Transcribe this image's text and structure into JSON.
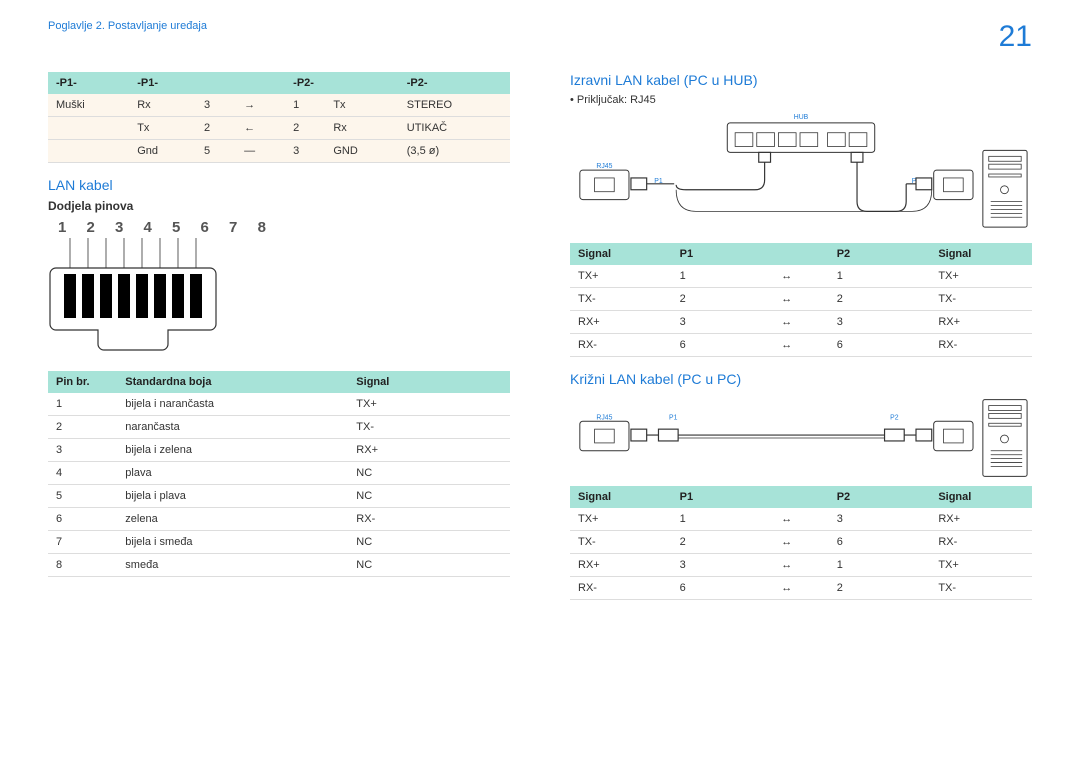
{
  "header": {
    "breadcrumb": "Poglavlje 2. Postavljanje uređaja",
    "page_number": "21"
  },
  "left": {
    "table1": {
      "headers": [
        "-P1-",
        "-P1-",
        "",
        "-P2-",
        "-P2-",
        ""
      ],
      "rows": [
        [
          "Muški",
          "Rx",
          "3",
          "→",
          "1",
          "Tx",
          "STEREO"
        ],
        [
          "",
          "Tx",
          "2",
          "←",
          "2",
          "Rx",
          "UTIKAČ"
        ],
        [
          "",
          "Gnd",
          "5",
          "—",
          "3",
          "GND",
          "(3,5 ø)"
        ]
      ]
    },
    "section_lan": {
      "title": "LAN kabel",
      "subtitle": "Dodjela pinova",
      "pins_label": "1 2 3 4 5 6 7 8"
    },
    "table2": {
      "headers": [
        "Pin br.",
        "Standardna boja",
        "Signal"
      ],
      "rows": [
        [
          "1",
          "bijela i narančasta",
          "TX+"
        ],
        [
          "2",
          "narančasta",
          "TX-"
        ],
        [
          "3",
          "bijela i zelena",
          "RX+"
        ],
        [
          "4",
          "plava",
          "NC"
        ],
        [
          "5",
          "bijela i plava",
          "NC"
        ],
        [
          "6",
          "zelena",
          "RX-"
        ],
        [
          "7",
          "bijela i smeđa",
          "NC"
        ],
        [
          "8",
          "smeđa",
          "NC"
        ]
      ]
    }
  },
  "right": {
    "section_direct": {
      "title": "Izravni LAN kabel (PC u HUB)",
      "bullet": "Priključak: RJ45",
      "labels": {
        "hub": "HUB",
        "rj45": "RJ45",
        "p1": "P1",
        "p2": "P2"
      }
    },
    "table3": {
      "headers": [
        "Signal",
        "P1",
        "",
        "P2",
        "Signal"
      ],
      "rows": [
        [
          "TX+",
          "1",
          "↔",
          "1",
          "TX+"
        ],
        [
          "TX-",
          "2",
          "↔",
          "2",
          "TX-"
        ],
        [
          "RX+",
          "3",
          "↔",
          "3",
          "RX+"
        ],
        [
          "RX-",
          "6",
          "↔",
          "6",
          "RX-"
        ]
      ]
    },
    "section_cross": {
      "title": "Križni LAN kabel (PC u PC)",
      "labels": {
        "rj45": "RJ45",
        "p1": "P1",
        "p2": "P2"
      }
    },
    "table4": {
      "headers": [
        "Signal",
        "P1",
        "",
        "P2",
        "Signal"
      ],
      "rows": [
        [
          "TX+",
          "1",
          "↔",
          "3",
          "RX+"
        ],
        [
          "TX-",
          "2",
          "↔",
          "6",
          "RX-"
        ],
        [
          "RX+",
          "3",
          "↔",
          "1",
          "TX+"
        ],
        [
          "RX-",
          "6",
          "↔",
          "2",
          "TX-"
        ]
      ]
    }
  }
}
